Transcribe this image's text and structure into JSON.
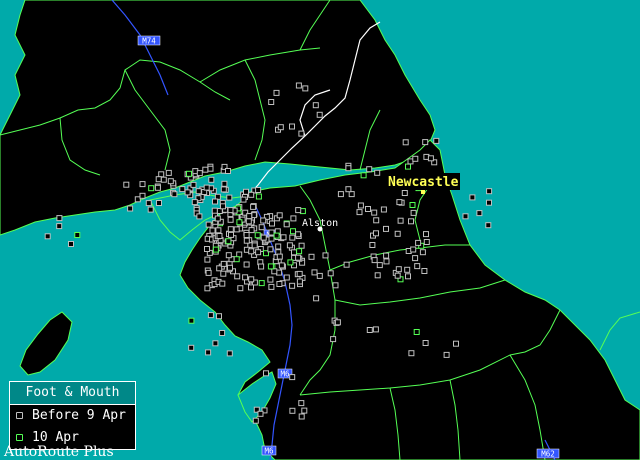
{
  "legend": {
    "title": "Foot & Mouth",
    "items": [
      {
        "label": "Before 9 Apr",
        "color": "#c0c0c0"
      },
      {
        "label": "10 Apr",
        "color": "#55ff55"
      }
    ]
  },
  "places": {
    "newcastle": "Newcastle",
    "alston": "Alston"
  },
  "roads": [
    "M74",
    "M6",
    "M6",
    "M6",
    "M62"
  ],
  "footer": "AutoRoute Plus",
  "colors": {
    "sea": "#00aaaa",
    "land": "#000000",
    "county_border": "#55ff55",
    "national_border": "#ffffff",
    "road": "#3355ff",
    "river": "#4488ff",
    "before_case": "#c0c0c0",
    "new_case": "#55ff55",
    "city_label": "#ffff55"
  }
}
